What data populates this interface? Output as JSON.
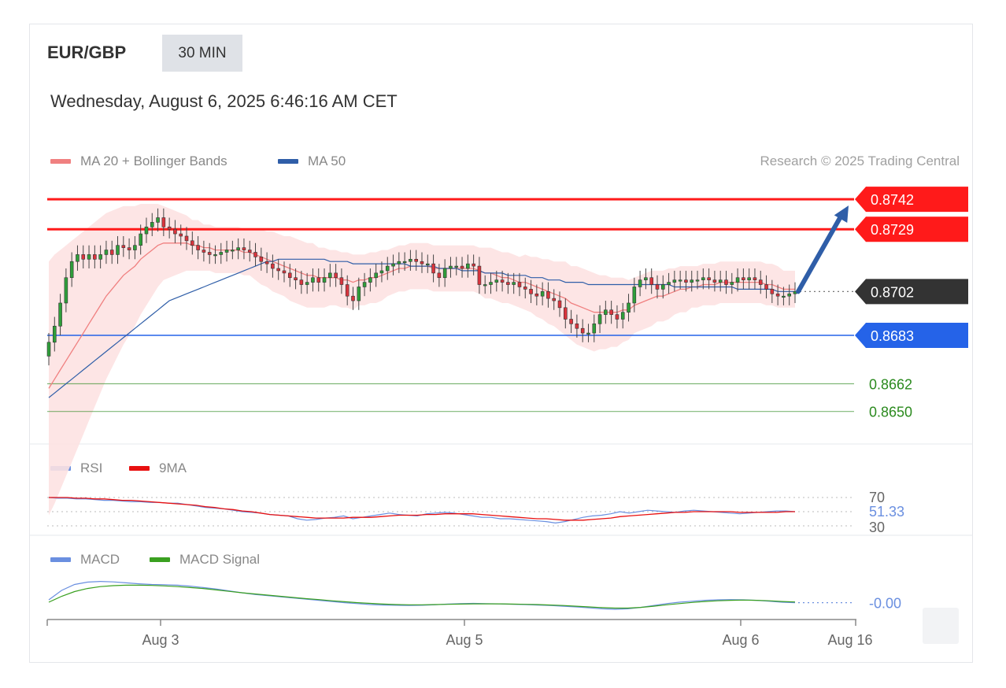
{
  "header": {
    "symbol": "EUR/GBP",
    "timeframe": "30 MIN",
    "datetime": "Wednesday, August 6, 2025 6:46:16 AM CET",
    "research": "Research © 2025 Trading Central"
  },
  "legend_main": [
    {
      "label": "MA 20 + Bollinger Bands",
      "color": "#f08080"
    },
    {
      "label": "MA 50",
      "color": "#2f5ea8"
    }
  ],
  "legend_rsi": [
    {
      "label": "RSI",
      "color": "#6a8fe0"
    },
    {
      "label": "9MA",
      "color": "#e81010"
    }
  ],
  "legend_macd": [
    {
      "label": "MACD",
      "color": "#6a8fe0"
    },
    {
      "label": "MACD Signal",
      "color": "#3aa020"
    }
  ],
  "colors": {
    "resistance": "#ff1a1a",
    "support_strong": "#2563e8",
    "support": "#2b8a1e",
    "current": "#333333",
    "bollinger": "#fde2e2",
    "arrow": "#2f5ea8"
  },
  "chart_data": [
    {
      "type": "line",
      "name": "price",
      "ylim": [
        0.864,
        0.8755
      ],
      "x_ticks": [
        "Aug 3",
        "Aug 5",
        "Aug 6",
        "Aug 16"
      ],
      "levels": [
        {
          "value": 0.8742,
          "label": "0.8742",
          "kind": "resistance"
        },
        {
          "value": 0.8729,
          "label": "0.8729",
          "kind": "resistance"
        },
        {
          "value": 0.8702,
          "label": "0.8702",
          "kind": "current"
        },
        {
          "value": 0.8683,
          "label": "0.8683",
          "kind": "support_strong"
        },
        {
          "value": 0.8662,
          "label": "0.8662",
          "kind": "support"
        },
        {
          "value": 0.865,
          "label": "0.8650",
          "kind": "support"
        }
      ],
      "close": [
        0.868,
        0.8687,
        0.8697,
        0.8708,
        0.8715,
        0.8718,
        0.8716,
        0.8718,
        0.8716,
        0.8718,
        0.872,
        0.8718,
        0.8722,
        0.8721,
        0.872,
        0.8722,
        0.8727,
        0.873,
        0.8732,
        0.8734,
        0.873,
        0.8729,
        0.8727,
        0.8726,
        0.8724,
        0.8722,
        0.872,
        0.8719,
        0.8718,
        0.8718,
        0.8719,
        0.872,
        0.872,
        0.8721,
        0.872,
        0.8719,
        0.8717,
        0.8715,
        0.8714,
        0.8712,
        0.8711,
        0.871,
        0.8708,
        0.8707,
        0.8705,
        0.8706,
        0.8708,
        0.8706,
        0.8708,
        0.871,
        0.8708,
        0.8705,
        0.87,
        0.8698,
        0.8704,
        0.8706,
        0.8708,
        0.871,
        0.8711,
        0.8713,
        0.8714,
        0.8715,
        0.8715,
        0.8716,
        0.8715,
        0.8714,
        0.8714,
        0.871,
        0.8708,
        0.8712,
        0.8713,
        0.8713,
        0.8712,
        0.8714,
        0.8713,
        0.8705,
        0.8705,
        0.8706,
        0.8707,
        0.8706,
        0.8705,
        0.8706,
        0.8704,
        0.8703,
        0.8701,
        0.87,
        0.8702,
        0.8699,
        0.8698,
        0.8695,
        0.869,
        0.8688,
        0.8686,
        0.8684,
        0.8684,
        0.8688,
        0.8692,
        0.8694,
        0.8692,
        0.869,
        0.8693,
        0.8697,
        0.8704,
        0.8707,
        0.8708,
        0.8705,
        0.8703,
        0.8705,
        0.8706,
        0.8707,
        0.8707,
        0.8706,
        0.8707,
        0.8707,
        0.8708,
        0.8707,
        0.8706,
        0.8707,
        0.8705,
        0.8706,
        0.8708,
        0.8707,
        0.8708,
        0.8707,
        0.8705,
        0.8703,
        0.8701,
        0.87,
        0.87,
        0.8701,
        0.8702
      ],
      "ma20": [
        0.866,
        0.8664,
        0.8668,
        0.8672,
        0.8676,
        0.868,
        0.8684,
        0.8688,
        0.8692,
        0.8696,
        0.87,
        0.8703,
        0.8706,
        0.8709,
        0.8711,
        0.8713,
        0.8716,
        0.8718,
        0.872,
        0.8722,
        0.8723,
        0.8723,
        0.8723,
        0.8723,
        0.8723,
        0.8722,
        0.8722,
        0.8721,
        0.8721,
        0.872,
        0.872,
        0.872,
        0.872,
        0.872,
        0.8719,
        0.8719,
        0.8718,
        0.8717,
        0.8716,
        0.8715,
        0.8714,
        0.8713,
        0.8712,
        0.8711,
        0.871,
        0.8709,
        0.8709,
        0.8708,
        0.8708,
        0.8708,
        0.8708,
        0.8707,
        0.8707,
        0.8706,
        0.8707,
        0.8707,
        0.8708,
        0.8708,
        0.8709,
        0.871,
        0.8711,
        0.8712,
        0.8712,
        0.8713,
        0.8713,
        0.8713,
        0.8713,
        0.8712,
        0.8712,
        0.8712,
        0.8712,
        0.8712,
        0.8712,
        0.8712,
        0.8712,
        0.8711,
        0.871,
        0.871,
        0.8709,
        0.8708,
        0.8708,
        0.8707,
        0.8706,
        0.8706,
        0.8705,
        0.8704,
        0.8703,
        0.8702,
        0.8701,
        0.87,
        0.8699,
        0.8697,
        0.8696,
        0.8695,
        0.8694,
        0.8693,
        0.8693,
        0.8693,
        0.8693,
        0.8693,
        0.8694,
        0.8694,
        0.8696,
        0.8697,
        0.8698,
        0.8699,
        0.87,
        0.87,
        0.8701,
        0.8702,
        0.8703,
        0.8703,
        0.8704,
        0.8704,
        0.8705,
        0.8705,
        0.8705,
        0.8706,
        0.8706,
        0.8706,
        0.8706,
        0.8706,
        0.8706,
        0.8706,
        0.8706,
        0.8705,
        0.8705,
        0.8704,
        0.8703,
        0.8703,
        0.8703
      ],
      "ma50": [
        0.8656,
        0.8658,
        0.866,
        0.8662,
        0.8664,
        0.8666,
        0.8668,
        0.867,
        0.8672,
        0.8674,
        0.8676,
        0.8678,
        0.868,
        0.8682,
        0.8684,
        0.8686,
        0.8688,
        0.869,
        0.8692,
        0.8694,
        0.8696,
        0.8698,
        0.8699,
        0.87,
        0.8701,
        0.8702,
        0.8703,
        0.8704,
        0.8705,
        0.8706,
        0.8707,
        0.8708,
        0.8709,
        0.871,
        0.8711,
        0.8712,
        0.8713,
        0.8714,
        0.8715,
        0.8715,
        0.8716,
        0.8716,
        0.8716,
        0.8716,
        0.8716,
        0.8716,
        0.8716,
        0.8716,
        0.8716,
        0.8715,
        0.8715,
        0.8715,
        0.8715,
        0.8714,
        0.8714,
        0.8714,
        0.8714,
        0.8714,
        0.8714,
        0.8714,
        0.8714,
        0.8714,
        0.8714,
        0.8713,
        0.8713,
        0.8713,
        0.8713,
        0.8713,
        0.8712,
        0.8712,
        0.8712,
        0.8712,
        0.8711,
        0.8711,
        0.8711,
        0.8711,
        0.871,
        0.871,
        0.871,
        0.871,
        0.8709,
        0.8709,
        0.8709,
        0.8709,
        0.8708,
        0.8708,
        0.8708,
        0.8707,
        0.8707,
        0.8707,
        0.8706,
        0.8706,
        0.8706,
        0.8706,
        0.8705,
        0.8705,
        0.8705,
        0.8705,
        0.8705,
        0.8705,
        0.8705,
        0.8705,
        0.8705,
        0.8705,
        0.8705,
        0.8705,
        0.8705,
        0.8705,
        0.8705,
        0.8704,
        0.8704,
        0.8704,
        0.8704,
        0.8704,
        0.8704,
        0.8704,
        0.8704,
        0.8704,
        0.8704,
        0.8704,
        0.8703,
        0.8703,
        0.8703,
        0.8703,
        0.8703,
        0.8703,
        0.8703,
        0.8702,
        0.8702,
        0.8702,
        0.8702
      ],
      "bb_width": [
        0.0055,
        0.0054,
        0.0052,
        0.005,
        0.0048,
        0.0046,
        0.0044,
        0.0042,
        0.004,
        0.0038,
        0.0036,
        0.0034,
        0.0032,
        0.003,
        0.0028,
        0.0026,
        0.0024,
        0.0022,
        0.002,
        0.0018,
        0.0016,
        0.0015,
        0.0014,
        0.0013,
        0.0012,
        0.0011,
        0.0011,
        0.001,
        0.001,
        0.001,
        0.001,
        0.001,
        0.001,
        0.001,
        0.001,
        0.001,
        0.0011,
        0.0012,
        0.0012,
        0.0013,
        0.0013,
        0.0013,
        0.0014,
        0.0014,
        0.0014,
        0.0014,
        0.0014,
        0.0013,
        0.0013,
        0.0012,
        0.0012,
        0.0012,
        0.0012,
        0.0012,
        0.0011,
        0.0011,
        0.0011,
        0.0011,
        0.0011,
        0.001,
        0.001,
        0.001,
        0.001,
        0.001,
        0.001,
        0.001,
        0.001,
        0.001,
        0.001,
        0.001,
        0.001,
        0.001,
        0.001,
        0.001,
        0.001,
        0.001,
        0.0011,
        0.0011,
        0.0011,
        0.0011,
        0.0011,
        0.0011,
        0.0011,
        0.0012,
        0.0012,
        0.0013,
        0.0013,
        0.0014,
        0.0014,
        0.0015,
        0.0016,
        0.0016,
        0.0017,
        0.0017,
        0.0017,
        0.0017,
        0.0016,
        0.0016,
        0.0015,
        0.0015,
        0.0014,
        0.0013,
        0.0012,
        0.0012,
        0.0012,
        0.0012,
        0.0011,
        0.0011,
        0.0011,
        0.001,
        0.001,
        0.001,
        0.0009,
        0.0009,
        0.0009,
        0.0009,
        0.0009,
        0.0009,
        0.0009,
        0.0009,
        0.0009,
        0.0009,
        0.0009,
        0.0009,
        0.0009,
        0.0009,
        0.0009,
        0.0009,
        0.0008,
        0.0008,
        0.0008
      ],
      "arrow_target": 0.8742
    },
    {
      "type": "line",
      "name": "RSI",
      "ylim": [
        30,
        70
      ],
      "ticks": [
        "70",
        "30"
      ],
      "current_label": "51.33",
      "rsi": [
        70,
        69,
        69,
        68,
        68,
        67,
        66,
        66,
        65,
        64,
        64,
        63,
        63,
        62,
        62,
        60,
        58,
        56,
        55,
        54,
        52,
        50,
        49,
        48,
        46,
        45,
        44,
        40,
        38,
        39,
        41,
        42,
        44,
        40,
        42,
        44,
        46,
        48,
        46,
        45,
        44,
        47,
        48,
        49,
        48,
        46,
        44,
        42,
        42,
        40,
        40,
        39,
        38,
        37,
        36,
        34,
        36,
        39,
        42,
        44,
        45,
        47,
        50,
        48,
        50,
        52,
        51,
        50,
        49,
        51,
        52,
        51,
        50,
        49,
        48,
        47,
        48,
        49,
        50,
        51,
        51,
        50
      ],
      "ma9": [
        70,
        70,
        70,
        69,
        69,
        68,
        68,
        67,
        66,
        66,
        65,
        64,
        63,
        62,
        61,
        60,
        59,
        57,
        56,
        54,
        53,
        51,
        50,
        48,
        46,
        45,
        44,
        43,
        42,
        41,
        41,
        41,
        41,
        42,
        42,
        42,
        43,
        44,
        45,
        45,
        45,
        46,
        46,
        47,
        47,
        47,
        47,
        46,
        45,
        44,
        43,
        42,
        41,
        40,
        40,
        39,
        38,
        38,
        38,
        39,
        40,
        41,
        43,
        44,
        45,
        46,
        47,
        48,
        49,
        49,
        50,
        50,
        50,
        50,
        50,
        49,
        49,
        49,
        49,
        49,
        50,
        50
      ]
    },
    {
      "type": "line",
      "name": "MACD",
      "current_label": "-0.00",
      "macd": [
        0.2,
        0.6,
        0.85,
        0.95,
        0.98,
        0.96,
        0.92,
        0.88,
        0.85,
        0.84,
        0.82,
        0.78,
        0.72,
        0.66,
        0.58,
        0.5,
        0.43,
        0.38,
        0.33,
        0.28,
        0.23,
        0.18,
        0.13,
        0.08,
        0.04,
        0.0,
        -0.02,
        -0.03,
        -0.04,
        -0.03,
        -0.01,
        0.02,
        0.04,
        0.05,
        0.04,
        0.03,
        0.01,
        0.0,
        -0.02,
        -0.04,
        -0.07,
        -0.1,
        -0.14,
        -0.18,
        -0.2,
        -0.18,
        -0.12,
        -0.04,
        0.04,
        0.1,
        0.14,
        0.18,
        0.2,
        0.21,
        0.2,
        0.18,
        0.14,
        0.1,
        0.08
      ],
      "signal": [
        0.1,
        0.35,
        0.55,
        0.68,
        0.76,
        0.8,
        0.82,
        0.82,
        0.81,
        0.79,
        0.76,
        0.72,
        0.68,
        0.62,
        0.56,
        0.5,
        0.45,
        0.4,
        0.35,
        0.3,
        0.25,
        0.21,
        0.16,
        0.12,
        0.08,
        0.05,
        0.02,
        0.0,
        -0.01,
        -0.01,
        0.0,
        0.01,
        0.02,
        0.03,
        0.03,
        0.03,
        0.02,
        0.01,
        0.0,
        -0.02,
        -0.04,
        -0.07,
        -0.1,
        -0.13,
        -0.15,
        -0.15,
        -0.12,
        -0.07,
        -0.01,
        0.04,
        0.09,
        0.13,
        0.16,
        0.18,
        0.19,
        0.18,
        0.16,
        0.13,
        0.11
      ]
    }
  ]
}
